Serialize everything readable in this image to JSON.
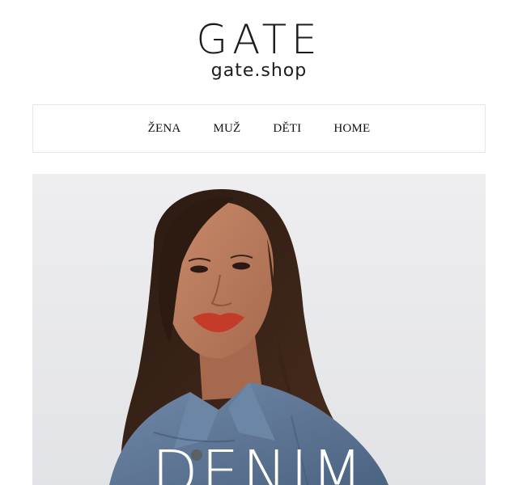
{
  "brand": {
    "logo_text": "GATE",
    "domain_text": "gate.shop"
  },
  "nav": {
    "items": [
      {
        "label": "ŽENA"
      },
      {
        "label": "MUŽ"
      },
      {
        "label": "DĚTI"
      },
      {
        "label": "HOME"
      }
    ]
  },
  "hero": {
    "title": "DENIM",
    "image_subject": "woman-in-denim-jacket"
  },
  "colors": {
    "background": "#ffffff",
    "hero_background": "#e9eaec",
    "denim": "#5b7394",
    "text": "#111111"
  }
}
